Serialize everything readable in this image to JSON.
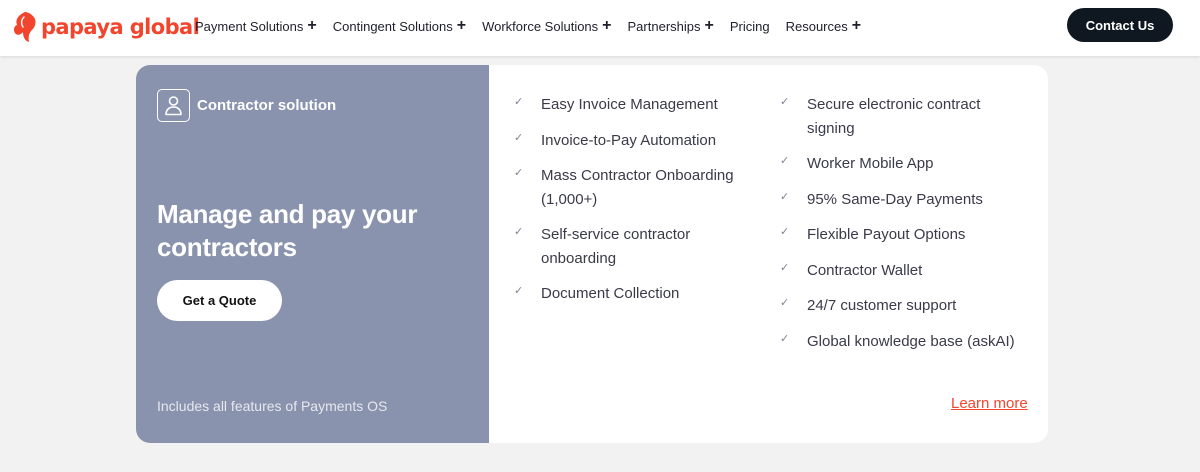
{
  "header": {
    "logo_text": "papaya global",
    "nav": [
      {
        "label": "Payment Solutions",
        "expandable": true
      },
      {
        "label": "Contingent Solutions",
        "expandable": true
      },
      {
        "label": "Workforce Solutions",
        "expandable": true
      },
      {
        "label": "Partnerships",
        "expandable": true
      },
      {
        "label": "Pricing",
        "expandable": false
      },
      {
        "label": "Resources",
        "expandable": true
      }
    ],
    "contact_label": "Contact Us"
  },
  "card": {
    "solution_icon": "user-icon",
    "solution_label": "Contractor solution",
    "headline": "Manage and pay your contractors",
    "quote_label": "Get a Quote",
    "includes_text": "Includes all features of Payments OS",
    "features_left": [
      "Easy Invoice Management",
      "Invoice-to-Pay Automation",
      "Mass Contractor Onboarding (1,000+)",
      "Self-service contractor onboarding",
      "Document Collection"
    ],
    "features_right": [
      "Secure electronic contract signing",
      "Worker Mobile App",
      "95% Same-Day Payments",
      "Flexible Payout Options",
      "Contractor Wallet",
      "24/7 customer support",
      "Global knowledge base (askAI)"
    ],
    "learn_more_label": "Learn more"
  },
  "colors": {
    "brand": "#f2452d",
    "panel": "#8a93ad",
    "dark_button": "#0f1720"
  }
}
